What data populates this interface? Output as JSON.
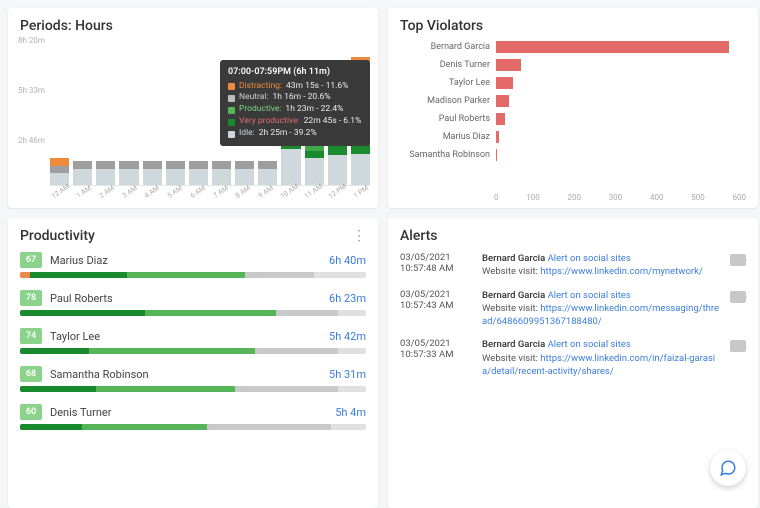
{
  "periods": {
    "title": "Periods: Hours",
    "yticks": [
      "8h 20m",
      "5h 33m",
      "2h 46m",
      ""
    ],
    "xticks": [
      "12 AM",
      "1 AM",
      "2 AM",
      "3 AM",
      "4 AM",
      "5 AM",
      "6 AM",
      "7 AM",
      "8 AM",
      "9 AM",
      "10 AM",
      "11 AM",
      "12 PM",
      "1 PM"
    ],
    "tooltip": {
      "title": "07:00-07:59PM (6h 11m)",
      "rows": [
        {
          "cls": "dist",
          "label": "Distracting",
          "val": "43m 15s - 11.6%"
        },
        {
          "cls": "neu",
          "label": "Neutral",
          "val": "1h 16m - 20.6%"
        },
        {
          "cls": "prod",
          "label": "Productive",
          "val": "1h 23m - 22.4%"
        },
        {
          "cls": "vp",
          "label": "Very productive",
          "val": "22m 45s - 6.1%"
        },
        {
          "cls": "idle",
          "label": "Idle",
          "val": "2h 25m - 39.2%"
        }
      ]
    }
  },
  "violators": {
    "title": "Top Violators",
    "max": 600,
    "xticks": [
      "0",
      "100",
      "200",
      "300",
      "400",
      "500",
      "600"
    ],
    "rows": [
      {
        "name": "Bernard Garcia",
        "value": 560
      },
      {
        "name": "Denis Turner",
        "value": 60
      },
      {
        "name": "Taylor Lee",
        "value": 40
      },
      {
        "name": "Madison Parker",
        "value": 30
      },
      {
        "name": "Paul Roberts",
        "value": 22
      },
      {
        "name": "Marius Diaz",
        "value": 8
      },
      {
        "name": "Samantha Robinson",
        "value": 2
      }
    ]
  },
  "productivity": {
    "title": "Productivity",
    "items": [
      {
        "score": "67",
        "name": "Marius Diaz",
        "time": "6h 40m",
        "segs": [
          3,
          28,
          34,
          20,
          15
        ]
      },
      {
        "score": "78",
        "name": "Paul Roberts",
        "time": "6h 23m",
        "segs": [
          0,
          36,
          38,
          18,
          8
        ]
      },
      {
        "score": "74",
        "name": "Taylor Lee",
        "time": "5h 42m",
        "segs": [
          0,
          20,
          48,
          24,
          8
        ]
      },
      {
        "score": "68",
        "name": "Samantha Robinson",
        "time": "5h 31m",
        "segs": [
          0,
          22,
          40,
          30,
          8
        ]
      },
      {
        "score": "60",
        "name": "Denis Turner",
        "time": "5h 4m",
        "segs": [
          0,
          18,
          36,
          36,
          10
        ]
      }
    ]
  },
  "alerts": {
    "title": "Alerts",
    "items": [
      {
        "date": "03/05/2021",
        "time": "10:57:48 AM",
        "who": "Bernard Garcia",
        "rule": "Alert on social sites",
        "desc": "Website visit:",
        "url": "https://www.linkedin.com/mynetwork/"
      },
      {
        "date": "03/05/2021",
        "time": "10:57:43 AM",
        "who": "Bernard Garcia",
        "rule": "Alert on social sites",
        "desc": "Website visit:",
        "url": "https://www.linkedin.com/messaging/thread/6486609951367188480/"
      },
      {
        "date": "03/05/2021",
        "time": "10:57:33 AM",
        "who": "Bernard Garcia",
        "rule": "Alert on social sites",
        "desc": "Website visit:",
        "url": "https://www.linkedin.com/in/faizal-garasia/detail/recent-activity/shares/"
      }
    ]
  },
  "chart_data": [
    {
      "type": "bar",
      "title": "Periods: Hours",
      "stacked": true,
      "xlabel": "",
      "ylabel": "",
      "ylim": [
        0,
        500
      ],
      "y_unit": "minutes",
      "categories": [
        "12 AM",
        "1 AM",
        "2 AM",
        "3 AM",
        "4 AM",
        "5 AM",
        "6 AM",
        "7 AM",
        "8 AM",
        "9 AM",
        "10 AM",
        "11 AM",
        "12 PM",
        "1 PM"
      ],
      "yticks_labels": [
        "",
        "2h 46m",
        "5h 33m",
        "8h 20m"
      ],
      "series": [
        {
          "name": "Idle",
          "color": "#cfd8dc",
          "values": [
            40,
            55,
            55,
            55,
            55,
            55,
            55,
            55,
            55,
            55,
            120,
            90,
            100,
            105
          ]
        },
        {
          "name": "Very productive",
          "color": "#1a8a2e",
          "values": [
            0,
            0,
            0,
            0,
            0,
            0,
            0,
            0,
            0,
            0,
            30,
            25,
            30,
            30
          ]
        },
        {
          "name": "Productive",
          "color": "#55b558",
          "values": [
            0,
            0,
            0,
            0,
            0,
            0,
            0,
            0,
            0,
            0,
            160,
            200,
            220,
            230
          ]
        },
        {
          "name": "Neutral",
          "color": "#9e9e9e",
          "values": [
            25,
            25,
            25,
            25,
            25,
            25,
            25,
            25,
            25,
            25,
            60,
            40,
            45,
            50
          ]
        },
        {
          "name": "Distracting",
          "color": "#ef8a3d",
          "values": [
            25,
            0,
            0,
            0,
            0,
            0,
            0,
            0,
            0,
            0,
            10,
            15,
            15,
            15
          ]
        }
      ]
    },
    {
      "type": "bar",
      "orientation": "horizontal",
      "title": "Top Violators",
      "xlabel": "",
      "ylabel": "",
      "xlim": [
        0,
        600
      ],
      "categories": [
        "Bernard Garcia",
        "Denis Turner",
        "Taylor Lee",
        "Madison Parker",
        "Paul Roberts",
        "Marius Diaz",
        "Samantha Robinson"
      ],
      "values": [
        560,
        60,
        40,
        30,
        22,
        8,
        2
      ],
      "color": "#e46a6a"
    }
  ]
}
